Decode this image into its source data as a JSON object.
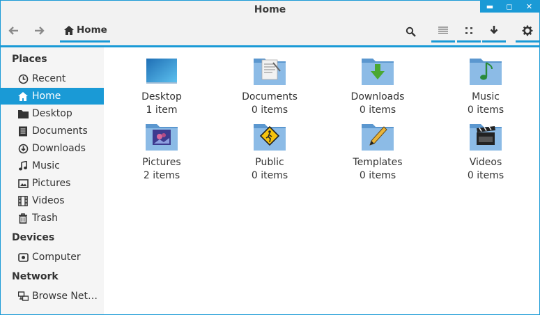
{
  "window": {
    "title": "Home",
    "controls": {
      "minimize": "▬",
      "maximize": "◻",
      "close": "✕"
    }
  },
  "toolbar": {
    "path_label": "Home",
    "back_icon": "arrow-left-icon",
    "forward_icon": "arrow-right-icon",
    "buttons": [
      "search-icon",
      "list-view-icon",
      "grid-view-icon",
      "download-icon",
      "gear-icon"
    ]
  },
  "sidebar": {
    "sections": {
      "places": "Places",
      "devices": "Devices",
      "network": "Network"
    },
    "places": [
      {
        "label": "Recent",
        "icon": "clock-icon"
      },
      {
        "label": "Home",
        "icon": "home-icon",
        "selected": true
      },
      {
        "label": "Desktop",
        "icon": "folder-icon"
      },
      {
        "label": "Documents",
        "icon": "document-icon"
      },
      {
        "label": "Downloads",
        "icon": "download-circle-icon"
      },
      {
        "label": "Music",
        "icon": "music-icon"
      },
      {
        "label": "Pictures",
        "icon": "picture-icon"
      },
      {
        "label": "Videos",
        "icon": "film-icon"
      },
      {
        "label": "Trash",
        "icon": "trash-icon"
      }
    ],
    "devices": [
      {
        "label": "Computer",
        "icon": "drive-icon"
      }
    ],
    "network": [
      {
        "label": "Browse Net…",
        "icon": "network-icon"
      }
    ]
  },
  "files": [
    {
      "name": "Desktop",
      "count": "1 item",
      "icon": "desktop-icon"
    },
    {
      "name": "Documents",
      "count": "0 items",
      "icon": "documents-folder-icon"
    },
    {
      "name": "Downloads",
      "count": "0 items",
      "icon": "downloads-folder-icon"
    },
    {
      "name": "Music",
      "count": "0 items",
      "icon": "music-folder-icon"
    },
    {
      "name": "Pictures",
      "count": "2 items",
      "icon": "pictures-folder-icon"
    },
    {
      "name": "Public",
      "count": "0 items",
      "icon": "public-folder-icon"
    },
    {
      "name": "Templates",
      "count": "0 items",
      "icon": "templates-folder-icon"
    },
    {
      "name": "Videos",
      "count": "0 items",
      "icon": "videos-folder-icon"
    }
  ],
  "colors": {
    "accent": "#1a9ad6",
    "folder": "#6ea6d8"
  }
}
